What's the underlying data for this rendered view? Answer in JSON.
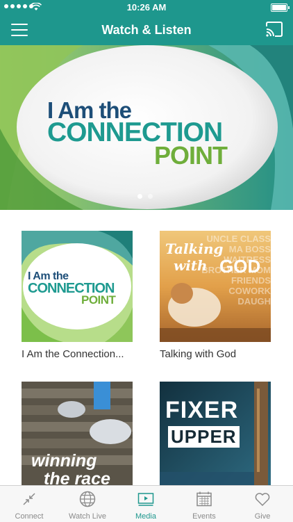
{
  "status_bar": {
    "time": "10:26 AM"
  },
  "nav": {
    "title": "Watch & Listen"
  },
  "hero": {
    "line1": "I Am the",
    "line2": "CONNECTION",
    "line3": "POINT",
    "page_count": 2,
    "active_page": 1
  },
  "media": [
    {
      "caption": "I Am the Connection...",
      "art_line1": "I Am the",
      "art_line2": "CONNECTION",
      "art_line3": "POINT"
    },
    {
      "caption": "Talking with God",
      "art_line1": "Talking",
      "art_line2": "with",
      "art_line3": "GOD",
      "art_bg_words": "UNCLE CLASS MA BOSS WAITRESS BROTHER MOM FRIENDS COWORK DAUGH"
    },
    {
      "caption": "",
      "art_line1": "winning",
      "art_line2": "the race"
    },
    {
      "caption": "",
      "art_line1": "FIXER",
      "art_line2": "UPPER"
    }
  ],
  "tabs": [
    {
      "label": "Connect",
      "icon": "connect-icon"
    },
    {
      "label": "Watch Live",
      "icon": "globe-icon"
    },
    {
      "label": "Media",
      "icon": "play-screen-icon"
    },
    {
      "label": "Events",
      "icon": "calendar-icon"
    },
    {
      "label": "Give",
      "icon": "heart-icon"
    }
  ],
  "colors": {
    "brand": "#1e978d",
    "tab_inactive": "#8a8a8a",
    "logo_navy": "#1d4e78",
    "logo_green": "#6fae3b"
  }
}
